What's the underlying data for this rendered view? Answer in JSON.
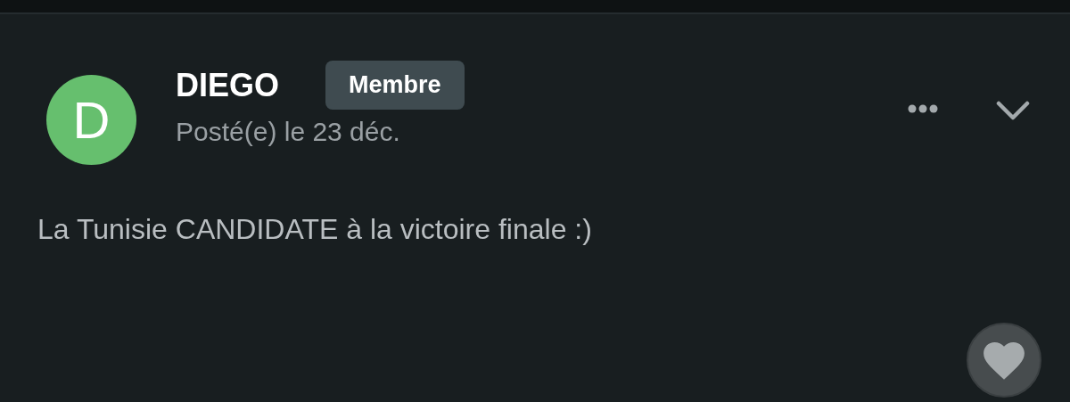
{
  "post": {
    "avatar_letter": "D",
    "author": "DIEGO",
    "badge": "Membre",
    "date": "Posté(e) le 23 déc.",
    "body": "La Tunisie CANDIDATE à la victoire finale :)"
  }
}
